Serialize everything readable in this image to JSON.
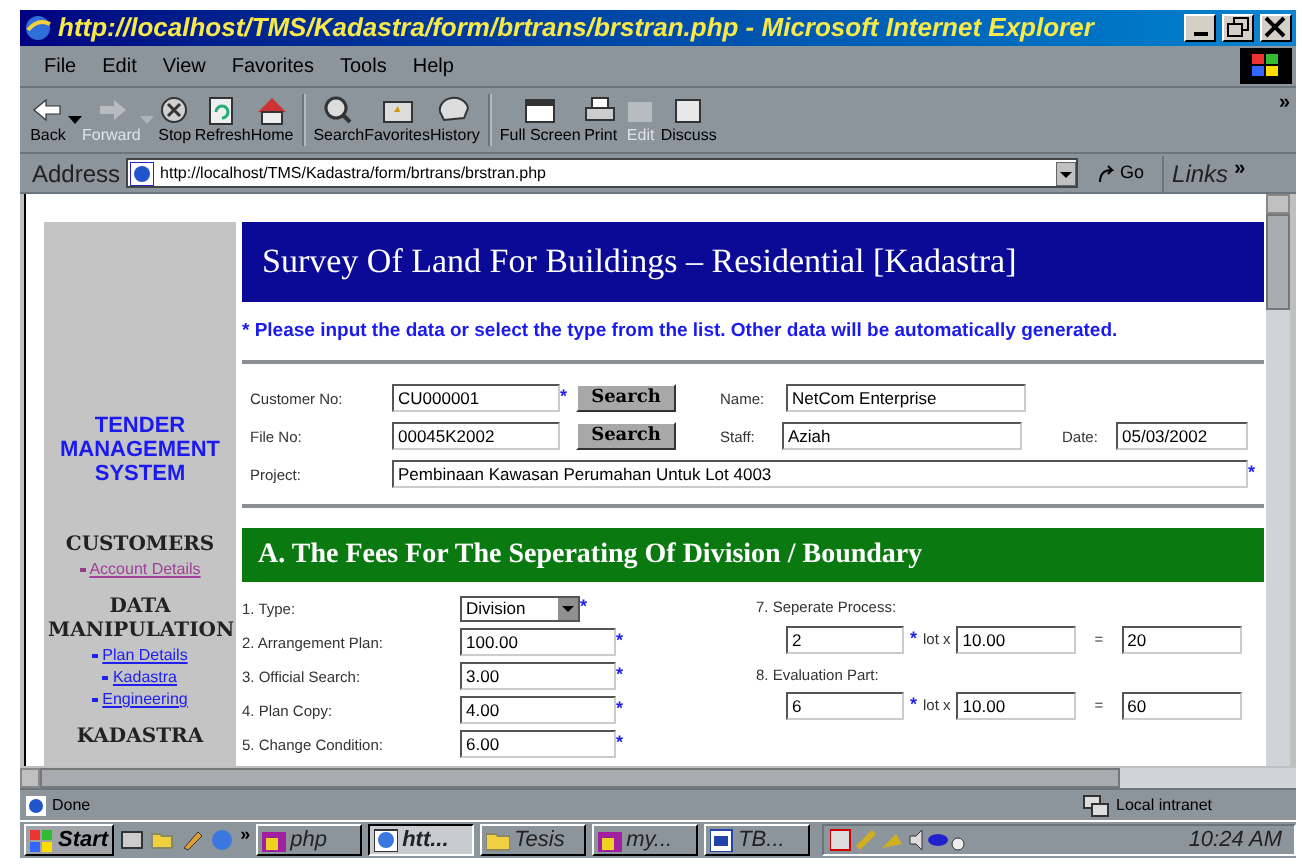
{
  "window": {
    "title": "http://localhost/TMS/Kadastra/form/brtrans/brstran.php - Microsoft Internet Explorer"
  },
  "menu": [
    "File",
    "Edit",
    "View",
    "Favorites",
    "Tools",
    "Help"
  ],
  "toolbar": {
    "buttons": [
      {
        "label": "Back",
        "disabled": false,
        "dropdown": true
      },
      {
        "label": "Forward",
        "disabled": true,
        "dropdown": true
      },
      {
        "label": "Stop",
        "disabled": false
      },
      {
        "label": "Refresh",
        "disabled": false
      },
      {
        "label": "Home",
        "disabled": false
      },
      {
        "label": "Search",
        "disabled": false
      },
      {
        "label": "Favorites",
        "disabled": false
      },
      {
        "label": "History",
        "disabled": false
      },
      {
        "label": "Full Screen",
        "disabled": false
      },
      {
        "label": "Print",
        "disabled": false
      },
      {
        "label": "Edit",
        "disabled": true
      },
      {
        "label": "Discuss",
        "disabled": false
      }
    ],
    "more": "»"
  },
  "address": {
    "label": "Address",
    "url": "http://localhost/TMS/Kadastra/form/brtrans/brstran.php",
    "go": "Go",
    "links": "Links",
    "more": "»"
  },
  "sidebar": {
    "title": "TENDER MANAGEMENT SYSTEM",
    "sections": [
      {
        "heading": "CUSTOMERS",
        "links": [
          {
            "text": "Account Details",
            "visited": true
          }
        ]
      },
      {
        "heading": "DATA MANIPULATION",
        "links": [
          {
            "text": "Plan Details",
            "visited": false
          },
          {
            "text": "Kadastra",
            "visited": false
          },
          {
            "text": "Engineering",
            "visited": false
          }
        ]
      },
      {
        "heading": "KADASTRA"
      }
    ]
  },
  "page": {
    "heading": "Survey Of Land For Buildings – Residential [Kadastra]",
    "instruction": "* Please input the data or select the type from the list. Other data will be automatically generated.",
    "customer": {
      "customer_no": {
        "label": "Customer No:",
        "value": "CU000001",
        "mark": "*",
        "button": "Search"
      },
      "file_no": {
        "label": "File No:",
        "value": "00045K2002",
        "button": "Search"
      },
      "name": {
        "label": "Name:",
        "value": "NetCom Enterprise"
      },
      "staff": {
        "label": "Staff:",
        "value": "Aziah"
      },
      "date": {
        "label": "Date:",
        "value": "05/03/2002"
      },
      "project": {
        "label": "Project:",
        "value": "Pembinaan  Kawasan Perumahan Untuk Lot 4003",
        "mark": "*"
      }
    },
    "section_a": {
      "title": "A. The Fees For The Seperating Of Division / Boundary",
      "items": [
        {
          "label": "1. Type:",
          "kind": "select",
          "value": "Division",
          "mark": "*"
        },
        {
          "label": "2. Arrangement Plan:",
          "kind": "input",
          "value": "100.00",
          "mark": "*"
        },
        {
          "label": "3. Official Search:",
          "kind": "input",
          "value": "3.00",
          "mark": "*"
        },
        {
          "label": "4. Plan Copy:",
          "kind": "input",
          "value": "4.00",
          "mark": "*"
        },
        {
          "label": "5. Change Condition:",
          "kind": "input",
          "value": "6.00",
          "mark": "*"
        }
      ],
      "calculations": [
        {
          "label": "7. Seperate Process:",
          "count": "2",
          "mark": "*",
          "times": "lot x",
          "rate": "10.00",
          "equals": "=",
          "total": "20"
        },
        {
          "label": "8. Evaluation Part:",
          "count": "6",
          "mark": "*",
          "times": "lot x",
          "rate": "10.00",
          "equals": "=",
          "total": "60"
        }
      ]
    }
  },
  "status_bar": {
    "text": "Done",
    "zone": "Local intranet"
  },
  "taskbar": {
    "start": "Start",
    "quick_more": "»",
    "buttons": [
      {
        "label": "php",
        "selected": false
      },
      {
        "label": "htt...",
        "selected": true
      },
      {
        "label": "Tesis",
        "selected": false
      },
      {
        "label": "my...",
        "selected": false
      },
      {
        "label": "TB...",
        "selected": false
      }
    ],
    "clock": "10:24 AM"
  }
}
